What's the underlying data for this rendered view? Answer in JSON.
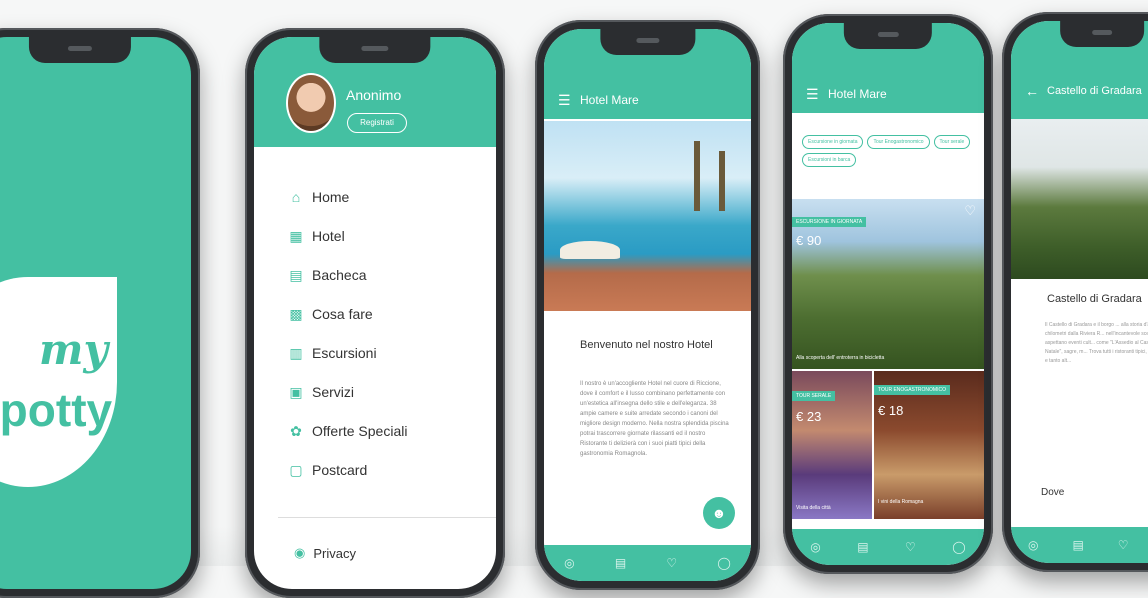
{
  "brand": {
    "logo_top": "my",
    "logo_bottom": "Spotty",
    "accent": "#44c0a2"
  },
  "drawer": {
    "user_name": "Anonimo",
    "register_label": "Registrati",
    "items": [
      {
        "label": "Home",
        "icon": "home-icon"
      },
      {
        "label": "Hotel",
        "icon": "hotel-icon"
      },
      {
        "label": "Bacheca",
        "icon": "board-icon"
      },
      {
        "label": "Cosa fare",
        "icon": "activity-icon"
      },
      {
        "label": "Escursioni",
        "icon": "map-icon"
      },
      {
        "label": "Servizi",
        "icon": "services-icon"
      },
      {
        "label": "Offerte Speciali",
        "icon": "offer-icon"
      },
      {
        "label": "Postcard",
        "icon": "postcard-icon"
      }
    ],
    "privacy_label": "Privacy"
  },
  "hotel": {
    "title": "Hotel Mare",
    "welcome": "Benvenuto nel nostro Hotel",
    "body": "Il nostro è un'accogliente Hotel nel cuore di Riccione, dove il comfort e il lusso combinano perfettamente con un'estetica all'insegna dello stile e dell'eleganza. 38 ampie camere e suite arredate secondo i canoni del migliore design moderno. Nella nostra splendida piscina potrai trascorrere giornate rilassanti ed il nostro Ristorante ti delizierà con i suoi piatti tipici della gastronomia Romagnola."
  },
  "tours": {
    "title": "Hotel Mare",
    "chips": [
      "Escursione in giornata",
      "Tour Enogastronomico",
      "Tour serale",
      "Escursioni in barca"
    ],
    "main": {
      "tag": "ESCURSIONE IN GIORNATA",
      "price": "€ 90",
      "caption": "Alla scoperta dell' entroterra in bicicletta"
    },
    "left": {
      "tag": "TOUR SERALE",
      "price": "€ 23",
      "caption": "Visita della città"
    },
    "right": {
      "tag": "TOUR ENOGASTRONOMICO",
      "price": "€ 18",
      "caption": "I vini della Romagna"
    }
  },
  "castle": {
    "title": "Castello di Gradara",
    "heading": "Castello di Gradara",
    "body": "Il Castello di Gradara e il borgo ... alla storia d'amore di Paolo e Fr... A pochi chilometri dalla Riviera R... nell'incantevole scenario medioe... Gradara, ti aspettano eventi cult... come \"L'Assedio al Castello\", \"C... il \"Castello di Natale\", sagre, m... Trova tutti i ristoranti tipici, allog... le enoteche, le osterie e tanto alt...",
    "dove": "Dove"
  }
}
